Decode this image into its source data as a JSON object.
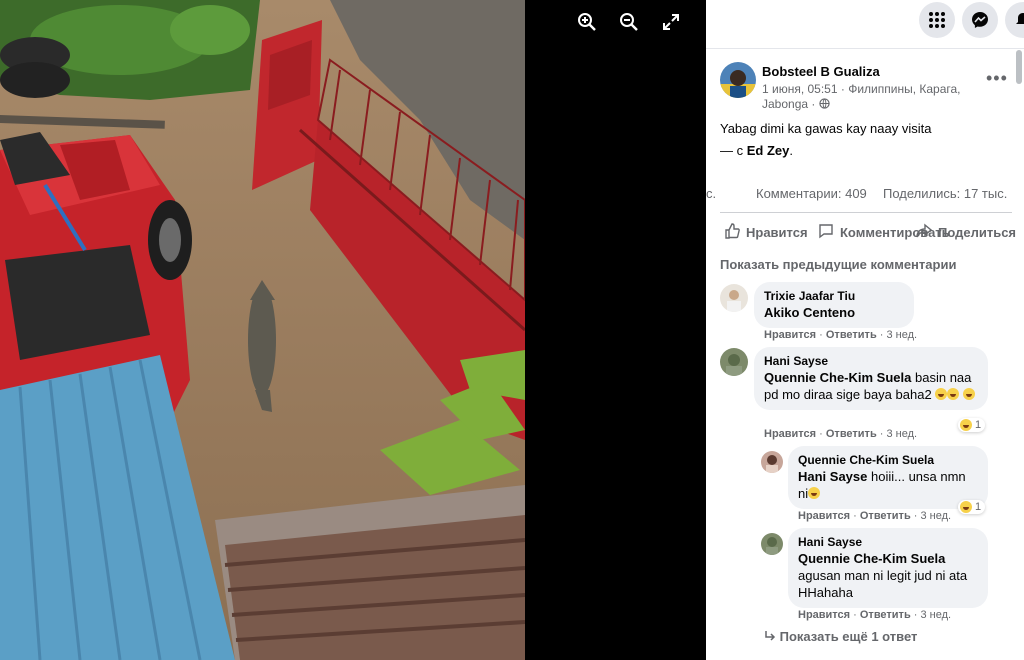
{
  "viewer": {
    "tools": [
      {
        "name": "zoom-in",
        "icon": "zoom-in-icon"
      },
      {
        "name": "zoom-out",
        "icon": "zoom-out-icon"
      },
      {
        "name": "fullscreen",
        "icon": "expand-icon"
      }
    ]
  },
  "topbar": {
    "icons": [
      "menu-grid-icon",
      "messenger-icon",
      "notifications-icon"
    ]
  },
  "post": {
    "author": "Bobsteel B Gualiza",
    "date": "1 июня, 05:51",
    "location": "Филиппины, Карага, Jabonga",
    "text": "Yabag dimi ka gawas kay naay visita",
    "with_prefix": "— с",
    "with_name": "Ed Zey",
    "with_suffix": "."
  },
  "stats": {
    "left": "с.",
    "comments": "Комментарии: 409",
    "shares": "Поделились: 17 тыс."
  },
  "actions": {
    "like": "Нравится",
    "comment": "Комментировать",
    "share": "Поделиться"
  },
  "prev_comments": "Показать предыдущие комментарии",
  "comments": [
    {
      "author": "Trixie Jaafar Tiu",
      "tag": "Akiko Centeno",
      "text": "",
      "like": "Нравится",
      "reply": "Ответить",
      "time": "3 нед."
    },
    {
      "author": "Hani Sayse",
      "tag": "Quennie Che-Kim Suela",
      "text": "basin naa pd mo diraa sige baya baha2",
      "like": "Нравится",
      "reply": "Ответить",
      "time": "3 нед.",
      "reactions": "1"
    },
    {
      "author": "Quennie Che-Kim Suela",
      "tag": "Hani Sayse",
      "text": "hoiii... unsa nmn ni",
      "like": "Нравится",
      "reply": "Ответить",
      "time": "3 нед.",
      "reactions": "1"
    },
    {
      "author": "Hani Sayse",
      "tag": "Quennie Che-Kim Suela",
      "text": "agusan man ni legit jud ni ata HHahaha",
      "like": "Нравится",
      "reply": "Ответить",
      "time": "3 нед."
    }
  ],
  "more_replies": "Показать ещё 1 ответ",
  "colors": {
    "panel_bg": "#ffffff",
    "bubble_bg": "#f0f2f5",
    "secondary_text": "#65676b",
    "gate_red": "#b8232a",
    "car_red": "#d9232a",
    "roof_blue": "#5b9fc6"
  }
}
